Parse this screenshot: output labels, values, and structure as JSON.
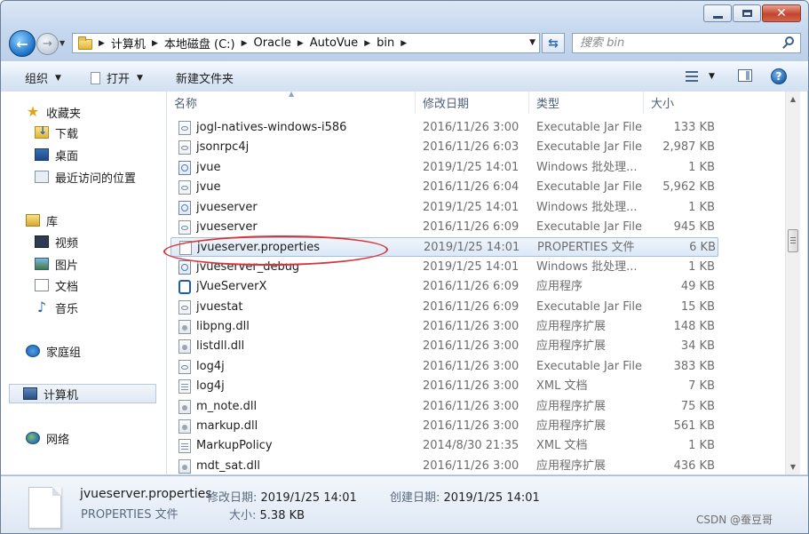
{
  "window": {
    "address": {
      "breadcrumbs": [
        "计算机",
        "本地磁盘 (C:)",
        "Oracle",
        "AutoVue",
        "bin"
      ]
    },
    "search": {
      "placeholder": "搜索 bin"
    }
  },
  "toolbar": {
    "organize": "组织",
    "open": "打开",
    "new_folder": "新建文件夹"
  },
  "navpane": {
    "favorites": "收藏夹",
    "downloads": "下载",
    "desktop": "桌面",
    "recent": "最近访问的位置",
    "libraries": "库",
    "videos": "视频",
    "pictures": "图片",
    "documents": "文档",
    "music": "音乐",
    "homegroup": "家庭组",
    "computer": "计算机",
    "network": "网络"
  },
  "columns": {
    "name": "名称",
    "date": "修改日期",
    "type": "类型",
    "size": "大小"
  },
  "files": [
    {
      "name": "jogl-natives-windows-i586",
      "date": "2016/11/26 3:00",
      "type": "Executable Jar File",
      "size": "133 KB",
      "icon": "jar"
    },
    {
      "name": "jsonrpc4j",
      "date": "2016/11/26 6:03",
      "type": "Executable Jar File",
      "size": "2,987 KB",
      "icon": "jar"
    },
    {
      "name": "jvue",
      "date": "2019/1/25 14:01",
      "type": "Windows 批处理...",
      "size": "1 KB",
      "icon": "bat"
    },
    {
      "name": "jvue",
      "date": "2016/11/26 6:04",
      "type": "Executable Jar File",
      "size": "5,962 KB",
      "icon": "jar"
    },
    {
      "name": "jvueserver",
      "date": "2019/1/25 14:01",
      "type": "Windows 批处理...",
      "size": "1 KB",
      "icon": "bat"
    },
    {
      "name": "jvueserver",
      "date": "2016/11/26 6:09",
      "type": "Executable Jar File",
      "size": "945 KB",
      "icon": "jar"
    },
    {
      "name": "jvueserver.properties",
      "date": "2019/1/25 14:01",
      "type": "PROPERTIES 文件",
      "size": "6 KB",
      "icon": "doc",
      "selected": true
    },
    {
      "name": "jvueserver_debug",
      "date": "2019/1/25 14:01",
      "type": "Windows 批处理...",
      "size": "1 KB",
      "icon": "bat"
    },
    {
      "name": "jVueServerX",
      "date": "2016/11/26 6:09",
      "type": "应用程序",
      "size": "49 KB",
      "icon": "exe"
    },
    {
      "name": "jvuestat",
      "date": "2016/11/26 6:09",
      "type": "Executable Jar File",
      "size": "15 KB",
      "icon": "jar"
    },
    {
      "name": "libpng.dll",
      "date": "2016/11/26 3:00",
      "type": "应用程序扩展",
      "size": "148 KB",
      "icon": "dll"
    },
    {
      "name": "listdll.dll",
      "date": "2016/11/26 3:00",
      "type": "应用程序扩展",
      "size": "34 KB",
      "icon": "dll"
    },
    {
      "name": "log4j",
      "date": "2016/11/26 3:00",
      "type": "Executable Jar File",
      "size": "383 KB",
      "icon": "jar"
    },
    {
      "name": "log4j",
      "date": "2016/11/26 3:00",
      "type": "XML 文档",
      "size": "7 KB",
      "icon": "xml"
    },
    {
      "name": "m_note.dll",
      "date": "2016/11/26 3:00",
      "type": "应用程序扩展",
      "size": "75 KB",
      "icon": "dll"
    },
    {
      "name": "markup.dll",
      "date": "2016/11/26 3:00",
      "type": "应用程序扩展",
      "size": "561 KB",
      "icon": "dll"
    },
    {
      "name": "MarkupPolicy",
      "date": "2014/8/30 21:35",
      "type": "XML 文档",
      "size": "1 KB",
      "icon": "xml"
    },
    {
      "name": "mdt_sat.dll",
      "date": "2016/11/26 3:00",
      "type": "应用程序扩展",
      "size": "436 KB",
      "icon": "dll"
    }
  ],
  "details": {
    "name": "jvueserver.properties",
    "type": "PROPERTIES 文件",
    "modified_label": "修改日期:",
    "modified_value": "2019/1/25 14:01",
    "created_label": "创建日期:",
    "created_value": "2019/1/25 14:01",
    "size_label": "大小:",
    "size_value": "5.38 KB"
  },
  "watermark": "CSDN @蚕豆哥",
  "colors": {
    "annotation": "#d8353a",
    "selection": "#dbe8f7"
  }
}
